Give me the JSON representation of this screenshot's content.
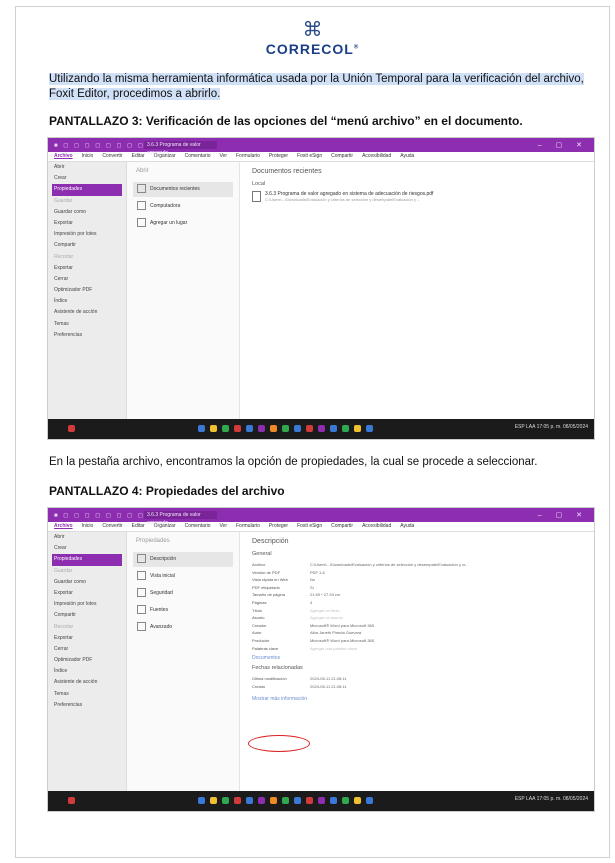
{
  "logo": {
    "mark": "⌘",
    "name": "CORRECOL",
    "reg": "®"
  },
  "para1": "Utilizando la misma herramienta informática usada por la Unión Temporal para la verificación del archivo, Foxit Editor, procedimos a abrirlo.",
  "heading3": "PANTALLAZO 3: Verificación de las opciones del “menú archivo” en el documento.",
  "para2": "En la pestaña archivo, encontramos la opción de propiedades, la cual se procede a seleccionar.",
  "heading4": "PANTALLAZO 4: Propiedades del archivo",
  "app": {
    "doc_title": "3.6.3 Programa de valor agregado...",
    "menu": [
      "Archivo",
      "Inicio",
      "Convertir",
      "Editar",
      "Organizar",
      "Comentario",
      "Ver",
      "Formulario",
      "Proteger",
      "Foxit eSign",
      "Compartir",
      "Accesibilidad",
      "Ayuda"
    ],
    "sidebar": [
      "Abrir",
      "Crear",
      "Propiedades",
      "Guardar",
      "Guardar como",
      "Exportar",
      "Impresión por lotes",
      "Compartir",
      "Recortar",
      "Exportar",
      "Cerrar",
      "Optimizador PDF",
      "Índice",
      "Asistente de acción",
      "Temas",
      "Preferencias"
    ],
    "dim_items": [
      "Guardar",
      "Recortar"
    ]
  },
  "shot3": {
    "col_head": "Abrir",
    "options": [
      "Documentos recientes",
      "Computadora",
      "Agregar un lugar"
    ],
    "main_title": "Documentos recientes",
    "group": "Local",
    "file_name": "3.6.3 Programa de valor agregado en sistema de adecuación de riesgos.pdf",
    "file_path": "C:\\Users\\...\\Downloads\\Evaluación y criterios de selección y desempate\\Evaluación y ..."
  },
  "shot4": {
    "col_head": "Propiedades",
    "options": [
      "Descripción",
      "Vista inicial",
      "Seguridad",
      "Fuentes",
      "Avanzado"
    ],
    "main_title": "Descripción",
    "section": "General",
    "props": [
      {
        "k": "Archivo",
        "v": "C:\\Users\\...\\Downloads\\Evaluación y criterios de selección y desempate\\Evaluación y cr..."
      },
      {
        "k": "Versión de PDF",
        "v": "PDF 1.6"
      },
      {
        "k": "Vista rápida en Web",
        "v": "No"
      },
      {
        "k": "PDF etiquetado",
        "v": "Sí"
      },
      {
        "k": "Tamaño de página",
        "v": "21.59 * 27.94 cm"
      },
      {
        "k": "Páginas",
        "v": "4"
      },
      {
        "k": "Título",
        "v": "Agregar un título"
      },
      {
        "k": "Asunto",
        "v": "Agregar un asunto"
      },
      {
        "k": "Creador",
        "v": "Microsoft® Word para Microsoft 365"
      },
      {
        "k": "Autor",
        "v": "Alba Janeth Pineda Guevara"
      },
      {
        "k": "Productor",
        "v": "Microsoft® Word para Microsoft 365"
      },
      {
        "k": "Palabras clave",
        "v": "Agregar una palabra clave"
      }
    ],
    "doc_link": "Documentos",
    "dates_title": "Fechas relacionadas",
    "dates": [
      {
        "k": "Última modificación",
        "v": "2024-05-11 21:28:11"
      },
      {
        "k": "Creado",
        "v": "2024-05-11 21:28:11"
      }
    ],
    "more_link": "Mostrar más información"
  },
  "taskbar": {
    "tray_text": "ESP LAA 17:05 p. m. 08/05/2024"
  },
  "colors": {
    "accent": "#8d2db0",
    "highlight": "#cfe0f7",
    "annotation": "#dd2222"
  }
}
